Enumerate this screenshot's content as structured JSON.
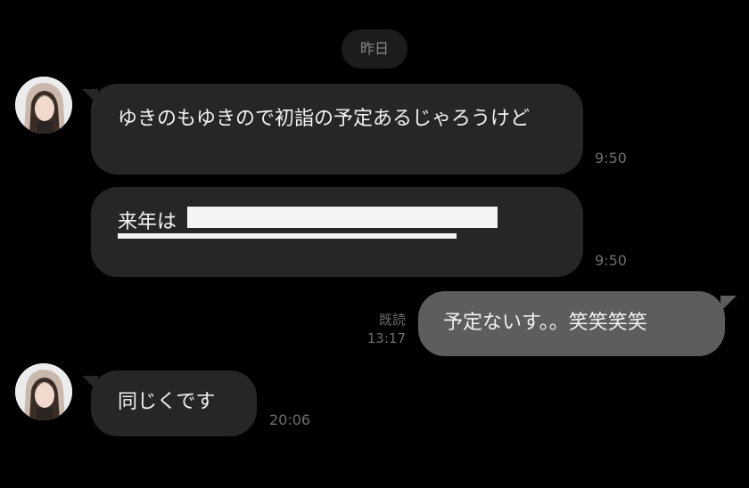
{
  "date_separator": "昨日",
  "messages": [
    {
      "text": "ゆきのもゆきので初詣の予定あるじゃろうけど",
      "time": "9:50"
    },
    {
      "text": "来年は",
      "time": "9:50"
    },
    {
      "text": "予定ないす。。笑笑笑笑",
      "read_label": "既読",
      "time": "13:17"
    },
    {
      "text": "同じくです",
      "time": "20:06"
    }
  ],
  "colors": {
    "background": "#000000",
    "incoming_bubble": "#262626",
    "outgoing_bubble": "#5d5d5d",
    "bubble_text": "#f2f2f2",
    "meta_text": "#6e6e6e"
  }
}
